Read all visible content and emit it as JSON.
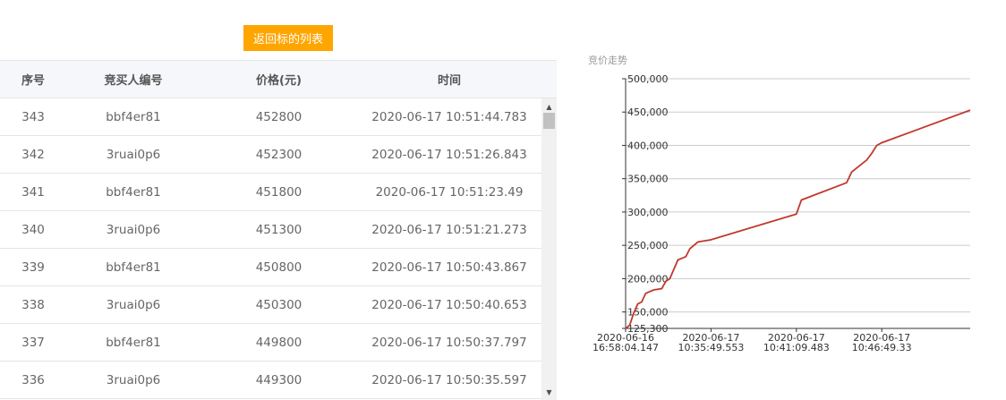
{
  "back_button": {
    "label": "返回标的列表"
  },
  "table": {
    "headers": [
      "序号",
      "竞买人编号",
      "价格(元)",
      "时间"
    ],
    "rows": [
      [
        "343",
        "bbf4er81",
        "452800",
        "2020-06-17 10:51:44.783"
      ],
      [
        "342",
        "3ruai0p6",
        "452300",
        "2020-06-17 10:51:26.843"
      ],
      [
        "341",
        "bbf4er81",
        "451800",
        "2020-06-17 10:51:23.49"
      ],
      [
        "340",
        "3ruai0p6",
        "451300",
        "2020-06-17 10:51:21.273"
      ],
      [
        "339",
        "bbf4er81",
        "450800",
        "2020-06-17 10:50:43.867"
      ],
      [
        "338",
        "3ruai0p6",
        "450300",
        "2020-06-17 10:50:40.653"
      ],
      [
        "337",
        "bbf4er81",
        "449800",
        "2020-06-17 10:50:37.797"
      ],
      [
        "336",
        "3ruai0p6",
        "449300",
        "2020-06-17 10:50:35.597"
      ]
    ]
  },
  "scrollbar": {
    "up_icon": "▲",
    "down_icon": "▼"
  },
  "chart_data": {
    "type": "line",
    "title": "竞价走势",
    "line_color": "#c0392b",
    "grid": true,
    "ylim": [
      125300,
      500000
    ],
    "y_ticks": [
      {
        "value": 500000,
        "label": "500,000"
      },
      {
        "value": 450000,
        "label": "450,000"
      },
      {
        "value": 400000,
        "label": "400,000"
      },
      {
        "value": 350000,
        "label": "350,000"
      },
      {
        "value": 300000,
        "label": "300,000"
      },
      {
        "value": 250000,
        "label": "250,000"
      },
      {
        "value": 200000,
        "label": "200,000"
      },
      {
        "value": 150000,
        "label": "150,000"
      },
      {
        "value": 125300,
        "label": "125,300"
      }
    ],
    "xlim": [
      0,
      343
    ],
    "x_ticks": [
      {
        "index": 0,
        "lines": [
          "2020-06-16",
          "16:58:04.147"
        ]
      },
      {
        "index": 85,
        "lines": [
          "2020-06-17",
          "10:35:49.553"
        ]
      },
      {
        "index": 170,
        "lines": [
          "2020-06-17",
          "10:41:09.483"
        ]
      },
      {
        "index": 255,
        "lines": [
          "2020-06-17",
          "10:46:49.33"
        ]
      }
    ],
    "series": [
      {
        "x": [
          0,
          4,
          8,
          12,
          16,
          20,
          28,
          36,
          40,
          44,
          52,
          60,
          64,
          72,
          80,
          84,
          170,
          175,
          220,
          225,
          240,
          245,
          250,
          255,
          343
        ],
        "y": [
          125300,
          130000,
          148000,
          162000,
          165000,
          178000,
          183000,
          185000,
          196000,
          200000,
          228000,
          233000,
          245000,
          255000,
          257000,
          258000,
          297000,
          318000,
          344000,
          360000,
          378000,
          388000,
          400000,
          404000,
          452800
        ]
      }
    ]
  }
}
